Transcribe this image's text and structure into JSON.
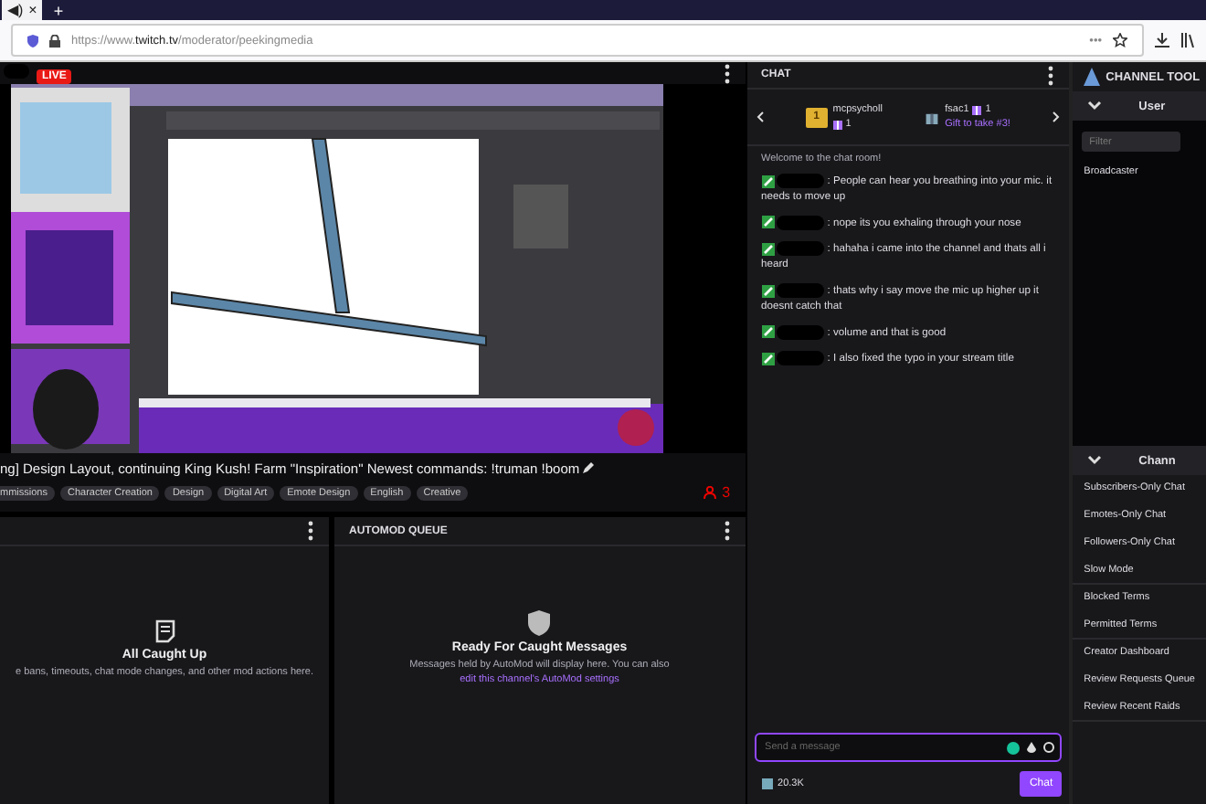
{
  "browser": {
    "tab_icon": "◀)",
    "tab_close": "×",
    "new_tab": "+",
    "url_prefix": "https://www.",
    "url_domain": "twitch.tv",
    "url_path": "/moderator/peekingmedia",
    "url_menu": "•••"
  },
  "stream": {
    "live_badge": "LIVE",
    "title": "ng] Design Layout, continuing King Kush! Farm \"Inspiration\" Newest commands: !truman !boom",
    "viewers": "3",
    "tags": [
      {
        "label": "mmissions"
      },
      {
        "label": "Character Creation"
      },
      {
        "label": "Design"
      },
      {
        "label": "Digital Art"
      },
      {
        "label": "Emote Design"
      },
      {
        "label": "English"
      },
      {
        "label": "Creative"
      }
    ]
  },
  "mod_actions": {
    "empty_title": "All Caught Up",
    "empty_text": "e bans, timeouts, chat mode changes, and other mod actions here."
  },
  "automod": {
    "title": "AUTOMOD QUEUE",
    "empty_title": "Ready For Caught Messages",
    "empty_text": "Messages held by AutoMod will display here. You can also ",
    "link": "edit this channel's AutoMod settings"
  },
  "chat": {
    "title": "CHAT",
    "gifts": [
      {
        "name": "mcpsycholl",
        "count": "1",
        "rank": "1"
      },
      {
        "name": "fsac1",
        "count": "1",
        "note": "Gift to take #3!"
      }
    ],
    "welcome": "Welcome to the chat room!",
    "messages": [
      {
        "text": ": People can hear you breathing into your mic. it needs to move up"
      },
      {
        "text": ": nope its you exhaling through your nose"
      },
      {
        "text": ": hahaha i came into the channel and thats all i heard"
      },
      {
        "text": ": thats why i say move the mic up higher up it doesnt catch that"
      },
      {
        "text": ": volume and that is good"
      },
      {
        "text": ": I also fixed the typo in your stream title"
      }
    ],
    "input": {
      "placeholder": "Send a message"
    },
    "points": "20.3K",
    "send": "Chat"
  },
  "channel_tools": {
    "title": "CHANNEL TOOL",
    "users_section": "User",
    "filter_placeholder": "Filter",
    "user_groups": [
      {
        "label": "Broadcaster"
      }
    ],
    "channel_section": "Chann",
    "groups": [
      [
        "Subscribers-Only Chat",
        "Emotes-Only Chat",
        "Followers-Only Chat",
        "Slow Mode"
      ],
      [
        "Blocked Terms",
        "Permitted Terms"
      ],
      [
        "Creator Dashboard",
        "Review Requests Queue",
        "Review Recent Raids"
      ]
    ]
  }
}
